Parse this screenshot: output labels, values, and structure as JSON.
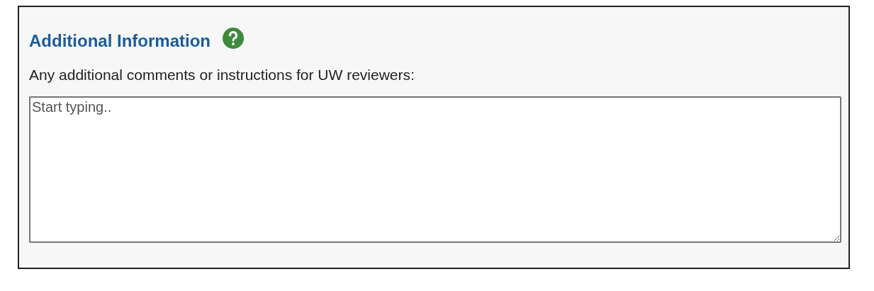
{
  "section": {
    "title": "Additional Information"
  },
  "prompt": "Any additional comments or instructions for UW reviewers:",
  "comments": {
    "placeholder": "Start typing.."
  }
}
